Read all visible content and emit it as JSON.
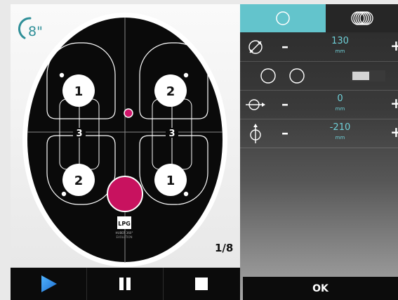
{
  "timer": {
    "value": "8\""
  },
  "diagram": {
    "pads": [
      {
        "label": "1"
      },
      {
        "label": "2"
      },
      {
        "label": "2"
      },
      {
        "label": "1"
      }
    ],
    "zones": [
      {
        "label": "3"
      },
      {
        "label": "3"
      }
    ],
    "logo": {
      "text": "LPG",
      "caption": "HUBER 360°",
      "subcaption": "EVOLUTION"
    },
    "page_counter": "1/8"
  },
  "controls": {
    "play_icon": "play-icon",
    "pause_icon": "pause-icon",
    "stop_icon": "stop-icon"
  },
  "settings": {
    "tabs": [
      {
        "name": "single-circle",
        "icon": "circle-icon",
        "active": true
      },
      {
        "name": "multi-circle",
        "icon": "multi-circle-icon",
        "active": false
      }
    ],
    "rows": [
      {
        "icon": "diameter-icon",
        "value": "130",
        "unit": "mm",
        "minus": "–",
        "plus": "+"
      },
      {
        "icon": "double-circle-icon",
        "toggle": "off"
      },
      {
        "icon": "horizontal-offset-icon",
        "value": "0",
        "unit": "mm",
        "minus": "–",
        "plus": "+"
      },
      {
        "icon": "vertical-offset-icon",
        "value": "-210",
        "unit": "mm",
        "minus": "–",
        "plus": "+"
      }
    ],
    "ok_label": "OK"
  },
  "colors": {
    "accent": "#63c4cc",
    "value_text": "#6fd0d8",
    "marker": "#d1156b",
    "timer": "#2f8f98"
  }
}
